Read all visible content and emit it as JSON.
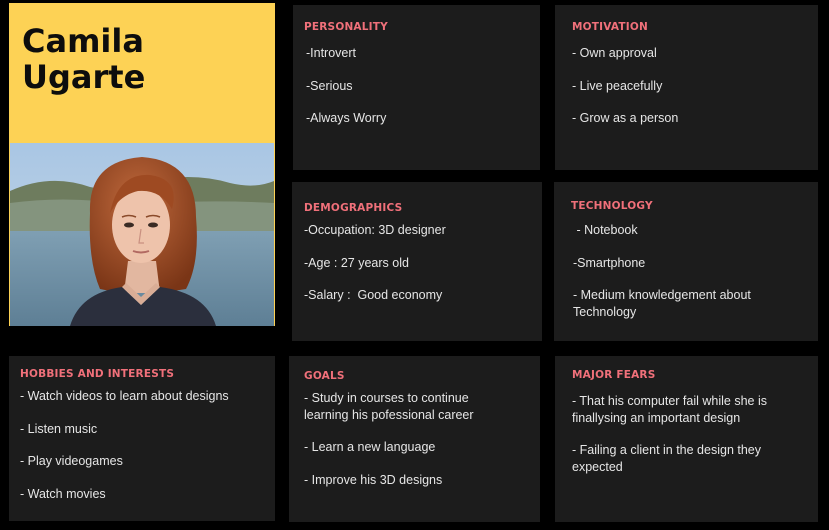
{
  "persona": {
    "name_line1": "Camila",
    "name_line2": "Ugarte"
  },
  "colors": {
    "name_background": "#fdd255",
    "card_background": "#1c1c1c",
    "heading": "#f0707a",
    "page_background": "#000000"
  },
  "personality": {
    "title": "PERSONALITY",
    "items": [
      "-Introvert",
      "-Serious",
      "-Always Worry"
    ]
  },
  "motivation": {
    "title": "MOTIVATION",
    "items": [
      "- Own approval",
      "- Live peacefully",
      "- Grow as a person"
    ]
  },
  "demographics": {
    "title": "DEMOGRAPHICS",
    "items": [
      "-Occupation: 3D designer",
      "-Age : 27 years old",
      "-Salary :  Good economy"
    ]
  },
  "technology": {
    "title": "TECHNOLOGY",
    "items": [
      " - Notebook",
      "-Smartphone",
      "- Medium knowledgement about Technology"
    ]
  },
  "hobbies": {
    "title": "HOBBIES AND INTERESTS",
    "items": [
      "- Watch videos to learn about designs",
      "- Listen music",
      "- Play videogames",
      "- Watch movies"
    ]
  },
  "goals": {
    "title": "GOALS",
    "items": [
      "- Study in courses to continue learning his pofessional career",
      "- Learn a new language",
      "- Improve his 3D designs"
    ]
  },
  "fears": {
    "title": "MAJOR FEARS",
    "items": [
      "- That his computer fail while she is finallysing an important design",
      "- Failing a client in the design they expected"
    ]
  }
}
